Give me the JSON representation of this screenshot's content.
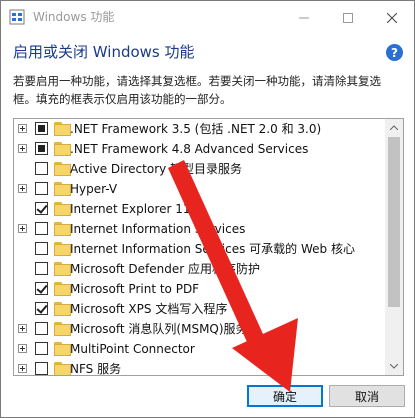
{
  "window": {
    "title": "Windows 功能"
  },
  "header": {
    "heading": "启用或关闭 Windows 功能",
    "description_line1": "若要启用一种功能，请选择其复选框。若要关闭一种功能，请清除其复选",
    "description_line2": "框。填充的框表示仅启用该功能的一部分。"
  },
  "features": [
    {
      "label": ".NET Framework 3.5 (包括 .NET 2.0 和 3.0)",
      "expandable": true,
      "state": "partial"
    },
    {
      "label": ".NET Framework 4.8 Advanced Services",
      "expandable": true,
      "state": "partial"
    },
    {
      "label": "Active Directory 轻型目录服务",
      "expandable": false,
      "state": "unchecked"
    },
    {
      "label": "Hyper-V",
      "expandable": true,
      "state": "unchecked"
    },
    {
      "label": "Internet Explorer 11",
      "expandable": false,
      "state": "checked"
    },
    {
      "label": "Internet Information Services",
      "expandable": true,
      "state": "unchecked"
    },
    {
      "label": "Internet Information Services 可承载的 Web 核心",
      "expandable": false,
      "state": "unchecked"
    },
    {
      "label": "Microsoft Defender 应用程序防护",
      "expandable": false,
      "state": "unchecked"
    },
    {
      "label": "Microsoft Print to PDF",
      "expandable": false,
      "state": "checked"
    },
    {
      "label": "Microsoft XPS 文档写入程序",
      "expandable": false,
      "state": "checked"
    },
    {
      "label": "Microsoft 消息队列(MSMQ)服务器",
      "expandable": true,
      "state": "unchecked"
    },
    {
      "label": "MultiPoint Connector",
      "expandable": true,
      "state": "unchecked"
    },
    {
      "label": "NFS 服务",
      "expandable": true,
      "state": "unchecked"
    }
  ],
  "buttons": {
    "ok": "确定",
    "cancel": "取消"
  },
  "colors": {
    "accent": "#0078d7",
    "heading": "#1a3a8a",
    "annotation_arrow": "#e8241f",
    "folder": "#f6d56a"
  }
}
